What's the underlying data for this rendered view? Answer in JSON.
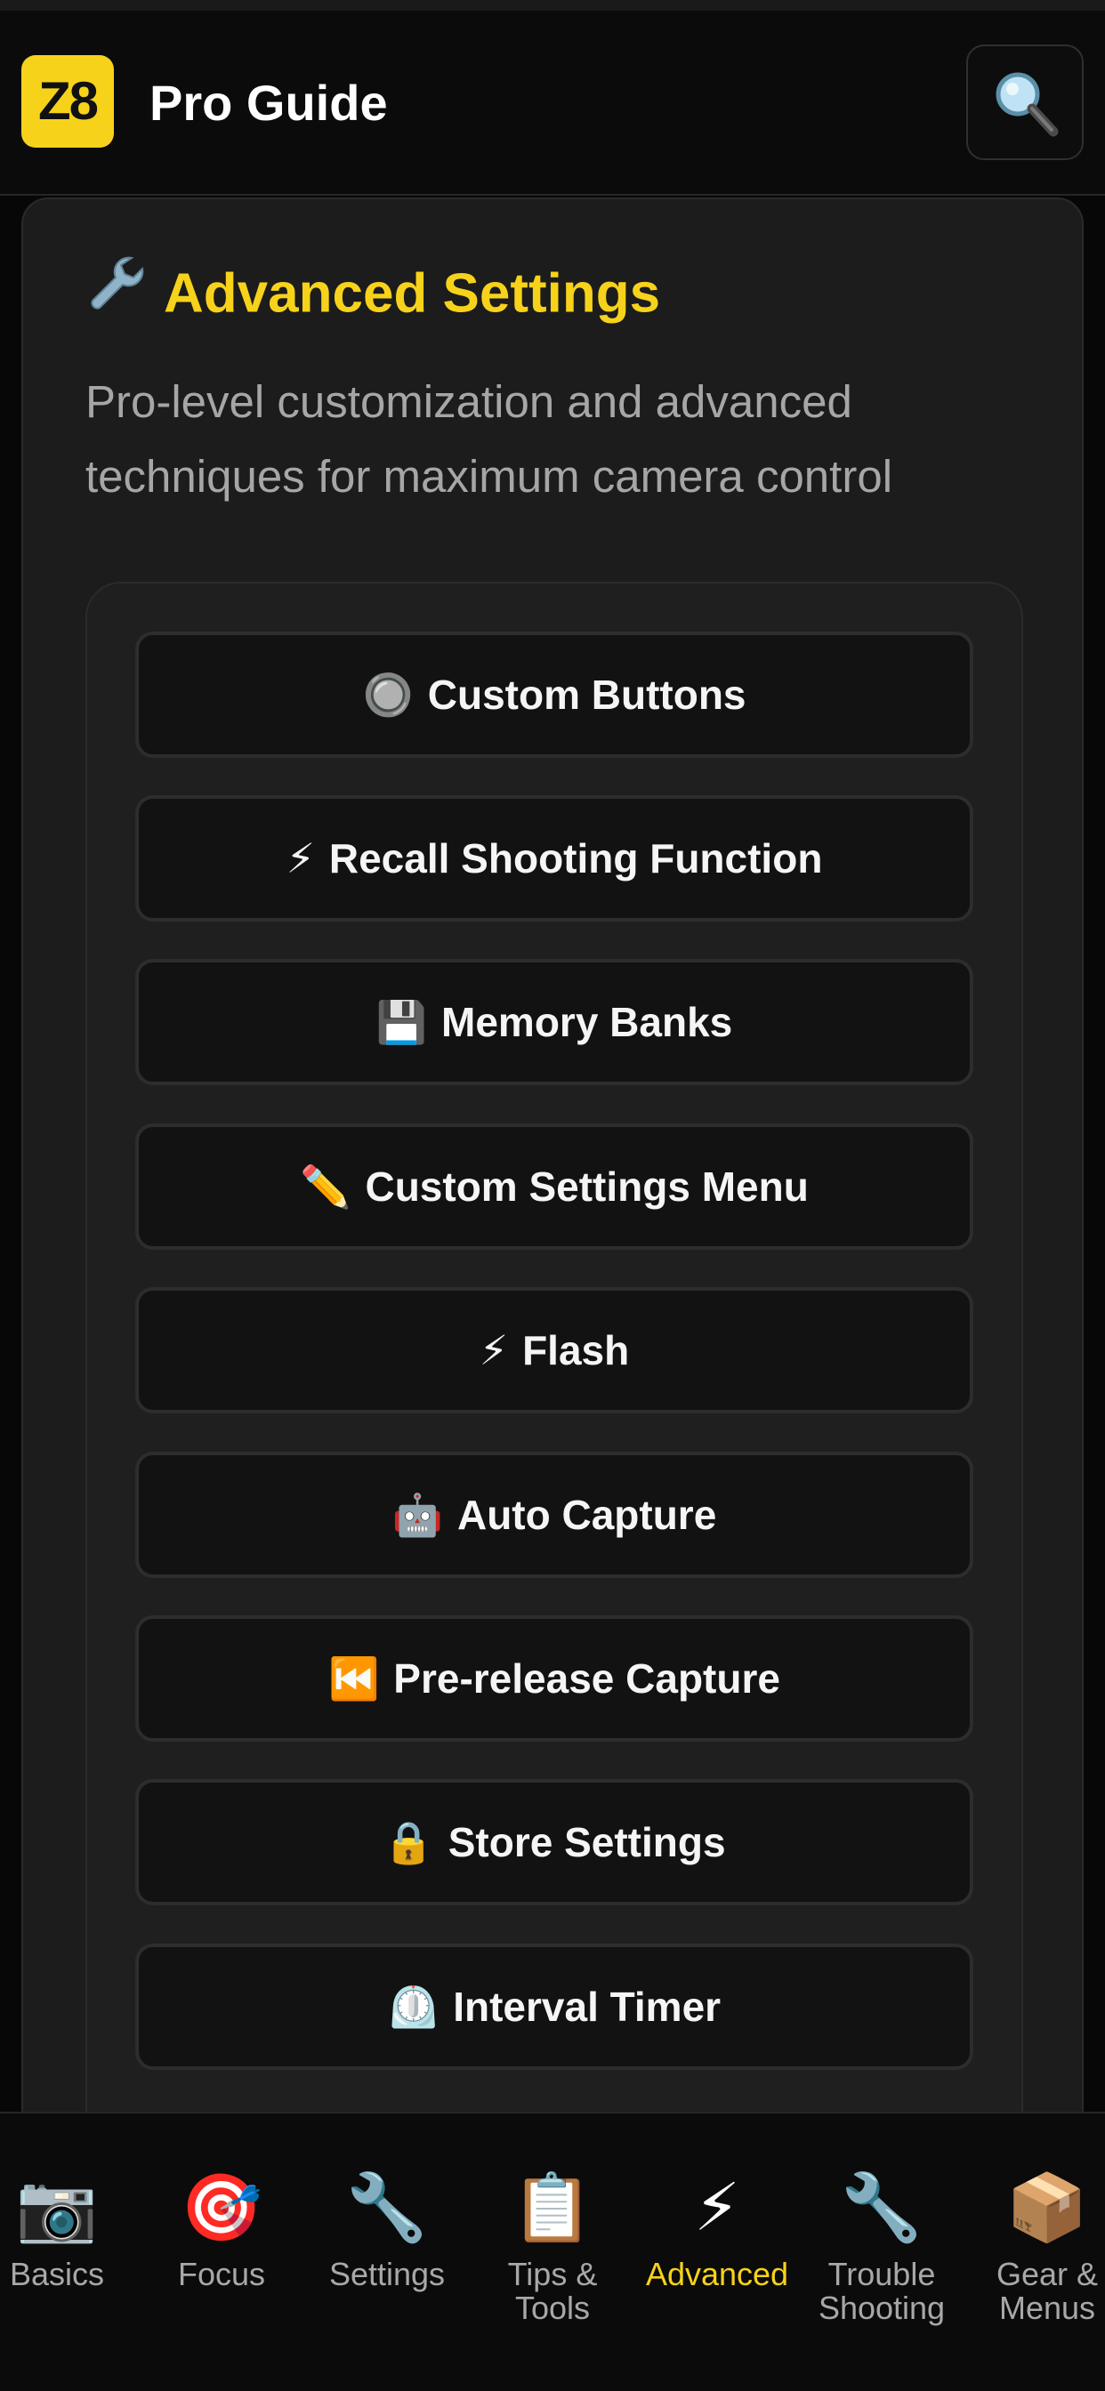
{
  "app": {
    "logo_text": "Z8",
    "title": "Pro Guide",
    "brand_color": "#f7d21b"
  },
  "header": {
    "search_icon": "search-icon"
  },
  "section": {
    "title": "Advanced Settings",
    "title_icon": "wrench-icon",
    "description": "Pro-level customization and advanced techniques for maximum camera control"
  },
  "menu": {
    "items": [
      {
        "icon": "🔘",
        "label": "Custom Buttons"
      },
      {
        "icon": "⚡",
        "label": "Recall Shooting Function"
      },
      {
        "icon": "💾",
        "label": "Memory Banks"
      },
      {
        "icon": "✏️",
        "label": "Custom Settings Menu"
      },
      {
        "icon": "⚡",
        "label": "Flash"
      },
      {
        "icon": "🤖",
        "label": "Auto Capture"
      },
      {
        "icon": "⏮️",
        "label": "Pre-release Capture"
      },
      {
        "icon": "🔒",
        "label": "Store Settings"
      },
      {
        "icon": "⏲️",
        "label": "Interval Timer"
      }
    ]
  },
  "nav": {
    "active": "Advanced",
    "items": [
      {
        "icon": "📷",
        "label": "Basics"
      },
      {
        "icon": "🎯",
        "label": "Focus"
      },
      {
        "icon": "🔧",
        "label": "Settings"
      },
      {
        "icon": "📋",
        "label": "Tips & Tools"
      },
      {
        "icon": "⚡",
        "label": "Advanced"
      },
      {
        "icon": "🔧",
        "label": "Trouble Shooting"
      },
      {
        "icon": "📦",
        "label": "Gear & Menus"
      }
    ]
  }
}
